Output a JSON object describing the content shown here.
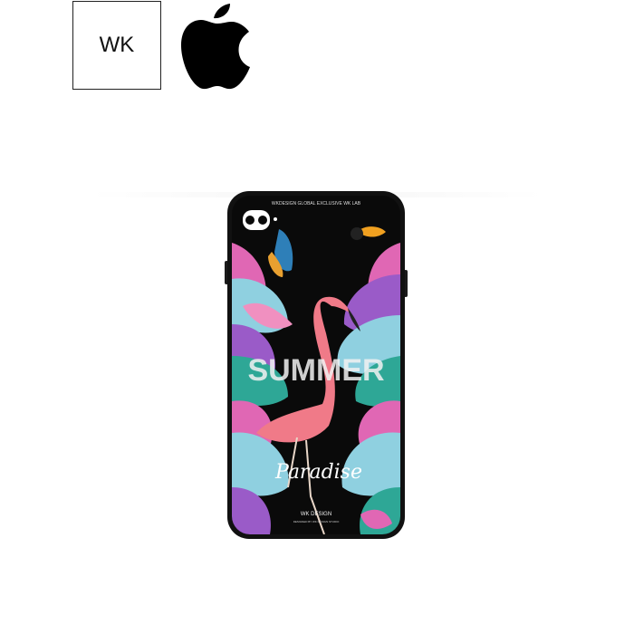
{
  "brand": {
    "label": "WK"
  },
  "case_print": {
    "top_text": "WKDESIGN GLOBAL EXCLUSIVE WK LAB",
    "headline": "SUMMER",
    "script": "Paradise",
    "bottom_brand": "WK DESIGN",
    "bottom_small": "DESIGNED BY WK DESIGN STUDIO"
  },
  "icons": {
    "apple": "apple-logo-icon",
    "camera": "camera-icon"
  },
  "colors": {
    "case_body": "#0a0a0a",
    "flamingo": "#f07a88",
    "leaf_blue": "#8fd0e0",
    "leaf_pink": "#e067b4",
    "leaf_purple": "#9a5bc8",
    "leaf_teal": "#2ea796"
  }
}
